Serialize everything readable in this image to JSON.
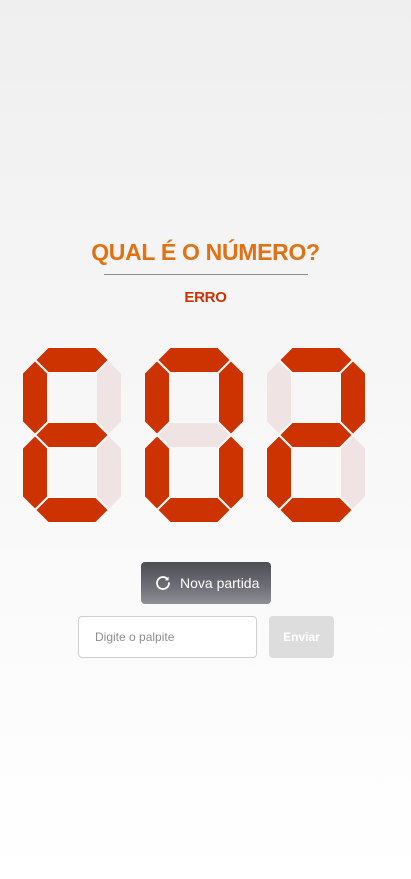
{
  "header": {
    "title": "QUAL É O NÚMERO?",
    "status": "ERRO"
  },
  "display": {
    "value": "ERR",
    "digits": [
      {
        "lit": [
          "a",
          "f",
          "g",
          "e",
          "d"
        ]
      },
      {
        "lit": [
          "a",
          "b",
          "c",
          "d",
          "e",
          "f"
        ]
      },
      {
        "lit": [
          "a",
          "b",
          "g",
          "e",
          "d"
        ]
      }
    ],
    "on_color": "#cc3300",
    "off_color": "#efe3e3"
  },
  "controls": {
    "new_game_label": "Nova partida",
    "new_game_icon": "refresh-icon",
    "guess_placeholder": "Digite o palpite",
    "guess_value": "",
    "send_label": "Enviar",
    "send_enabled": false
  },
  "colors": {
    "title": "#e07215",
    "status": "#cc3300",
    "button_dark": "#4d4d54",
    "button_disabled": "#dddddd"
  }
}
